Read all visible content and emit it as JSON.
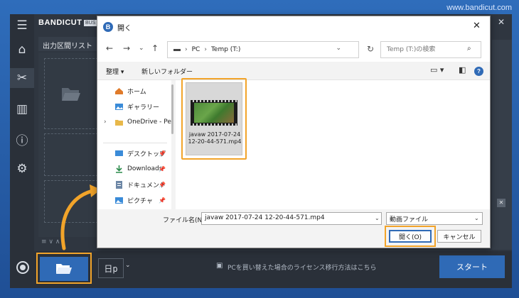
{
  "watermark": "www.bandicut.com",
  "app": {
    "brand": "BANDICUT",
    "brand_badge": "BUS",
    "panel_title": "出力区間リスト",
    "license_text": "PCを買い替えた場合のライセンス移行方法はこちら",
    "start_label": "スタート",
    "format_label": "日p"
  },
  "dialog": {
    "title": "開く",
    "address": {
      "root": "PC",
      "folder": "Temp (T:)"
    },
    "search_placeholder": "Temp (T:)の検索",
    "toolbar": {
      "organize": "整理",
      "new_folder": "新しいフォルダー"
    },
    "nav_items": [
      {
        "label": "ホーム"
      },
      {
        "label": "ギャラリー"
      },
      {
        "label": "OneDrive - Pers"
      },
      {
        "label": "デスクトップ"
      },
      {
        "label": "Downloads"
      },
      {
        "label": "ドキュメント"
      },
      {
        "label": "ピクチャ"
      }
    ],
    "file": {
      "name": "javaw 2017-07-24 12-20-44-571.mp4"
    },
    "filename_label": "ファイル名(N):",
    "filename_value": "javaw 2017-07-24 12-20-44-571.mp4",
    "filetype_value": "動画ファイル",
    "open_label": "開く(O)",
    "cancel_label": "キャンセル"
  },
  "colors": {
    "accent": "#2f6ab6",
    "highlight": "#f2a42a"
  }
}
